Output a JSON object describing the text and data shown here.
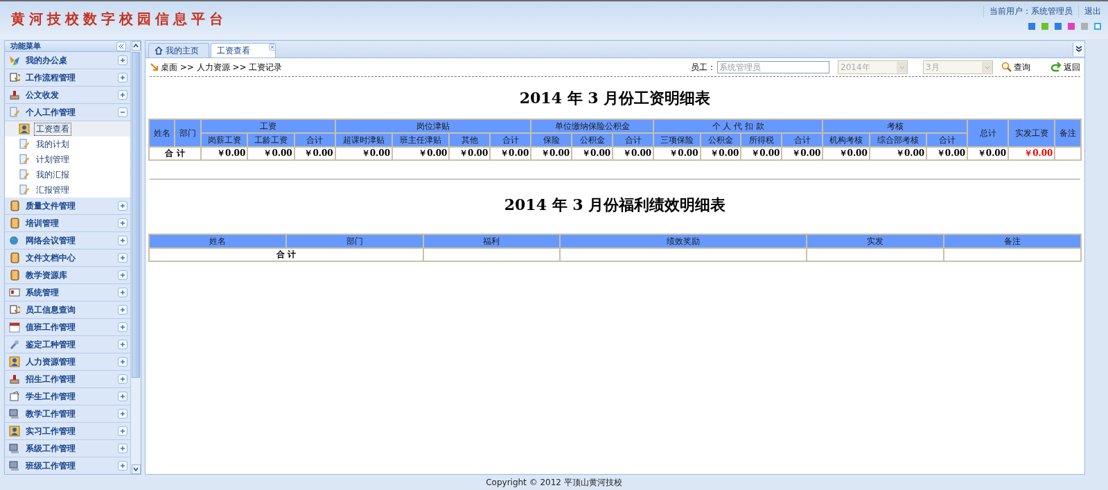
{
  "header": {
    "logo": "黄河技校数字校园信息平台",
    "user": "当前用户：系统管理员",
    "logout": "退出",
    "swatches": [
      {
        "color": "#2f7fe0",
        "kind": "square"
      },
      {
        "color": "#6cc22a",
        "kind": "square"
      },
      {
        "color": "#2f7fe0",
        "kind": "square"
      },
      {
        "color": "#e040c0",
        "kind": "square"
      },
      {
        "color": "#b0b0b0",
        "kind": "square"
      },
      {
        "color": "#3aa8e8",
        "kind": "frame"
      }
    ]
  },
  "sidebar": {
    "title": "功能菜单",
    "items": [
      {
        "label": "我的办公桌",
        "kind": "butterfly",
        "expanded": false
      },
      {
        "label": "工作流程管理",
        "kind": "cycle",
        "expanded": false
      },
      {
        "label": "公文收发",
        "kind": "inbox",
        "expanded": false
      },
      {
        "label": "个人工作管理",
        "kind": "note",
        "expanded": true,
        "children": [
          {
            "label": "工资查看",
            "kind": "user",
            "selected": true
          },
          {
            "label": "我的计划",
            "kind": "note",
            "selected": false
          },
          {
            "label": "计划管理",
            "kind": "note",
            "selected": false
          },
          {
            "label": "我的汇报",
            "kind": "note",
            "selected": false
          },
          {
            "label": "汇报管理",
            "kind": "note",
            "selected": false
          }
        ]
      },
      {
        "label": "质量文件管理",
        "kind": "folder",
        "expanded": false
      },
      {
        "label": "培训管理",
        "kind": "folder",
        "expanded": false
      },
      {
        "label": "网络会议管理",
        "kind": "globe",
        "expanded": false
      },
      {
        "label": "文件文档中心",
        "kind": "folder",
        "expanded": false
      },
      {
        "label": "教学资源库",
        "kind": "folder",
        "expanded": false
      },
      {
        "label": "系统管理",
        "kind": "card",
        "expanded": false
      },
      {
        "label": "员工信息查询",
        "kind": "cycle",
        "expanded": false
      },
      {
        "label": "值班工作管理",
        "kind": "calendar",
        "expanded": false
      },
      {
        "label": "鉴定工种管理",
        "kind": "wrench",
        "expanded": false
      },
      {
        "label": "人力资源管理",
        "kind": "user",
        "expanded": false
      },
      {
        "label": "招生工作管理",
        "kind": "inbox",
        "expanded": false
      },
      {
        "label": "学生工作管理",
        "kind": "clip",
        "expanded": false
      },
      {
        "label": "教学工作管理",
        "kind": "monitor",
        "expanded": false
      },
      {
        "label": "实习工作管理",
        "kind": "user",
        "expanded": false
      },
      {
        "label": "系级工作管理",
        "kind": "monitor",
        "expanded": false
      },
      {
        "label": "班级工作管理",
        "kind": "monitor",
        "expanded": false
      }
    ]
  },
  "tabs": [
    {
      "label": "我的主页",
      "kind": "home",
      "selected": false
    },
    {
      "label": "工资查看",
      "kind": "closable",
      "selected": true
    }
  ],
  "toolbar": {
    "breadcrumb": "桌面 >> 人力资源 >> 工资记录",
    "employee_label": "员工：",
    "employee": "系统管理员",
    "year": "2014年",
    "month": "3月",
    "search": "查询",
    "back": "返回"
  },
  "salary": {
    "title": "2014 年  3 月份工资明细表",
    "groups": [
      {
        "label": "姓名"
      },
      {
        "label": "部门"
      },
      {
        "label": "工资",
        "columns": [
          "岗薪工资",
          "工龄工资",
          "合计"
        ]
      },
      {
        "label": "岗位津贴",
        "columns": [
          "超课时津贴",
          "班主任津贴",
          "其他",
          "合计"
        ]
      },
      {
        "label": "单位缴纳保险公积金",
        "columns": [
          "保险",
          "公积金",
          "合计"
        ]
      },
      {
        "label": "个 人 代 扣 款",
        "columns": [
          "三项保险",
          "公积金",
          "所得税",
          "合计"
        ]
      },
      {
        "label": "考核",
        "columns": [
          "机构考核",
          "综合部考核",
          "合计"
        ]
      },
      {
        "label": "总计"
      },
      {
        "label": "实发工资"
      },
      {
        "label": "备注"
      }
    ],
    "total_label": "合  计",
    "totals": [
      {
        "text": "￥0.00",
        "kind": "normal"
      },
      {
        "text": "￥0.00",
        "kind": "normal"
      },
      {
        "text": "￥0.00",
        "kind": "normal"
      },
      {
        "text": "￥0.00",
        "kind": "normal"
      },
      {
        "text": "￥0.00",
        "kind": "normal"
      },
      {
        "text": "￥0.00",
        "kind": "normal"
      },
      {
        "text": "￥0.00",
        "kind": "normal"
      },
      {
        "text": "￥0.00",
        "kind": "normal"
      },
      {
        "text": "￥0.00",
        "kind": "normal"
      },
      {
        "text": "￥0.00",
        "kind": "normal"
      },
      {
        "text": "￥0.00",
        "kind": "normal"
      },
      {
        "text": "￥0.00",
        "kind": "normal"
      },
      {
        "text": "￥0.00",
        "kind": "normal"
      },
      {
        "text": "￥0.00",
        "kind": "normal"
      },
      {
        "text": "￥0.00",
        "kind": "normal"
      },
      {
        "text": "￥0.00",
        "kind": "normal"
      },
      {
        "text": "￥0.00",
        "kind": "normal"
      },
      {
        "text": "￥0.00",
        "kind": "normal"
      },
      {
        "text": "￥0.00",
        "kind": "net"
      }
    ]
  },
  "welfare": {
    "title": "2014 年  3 月份福利绩效明细表",
    "columns": [
      "姓名",
      "部门",
      "福利",
      "绩效奖励",
      "实发",
      "备注"
    ],
    "total_label": "合  计"
  },
  "footer": "Copyright © 2012 平顶山黄河技校"
}
